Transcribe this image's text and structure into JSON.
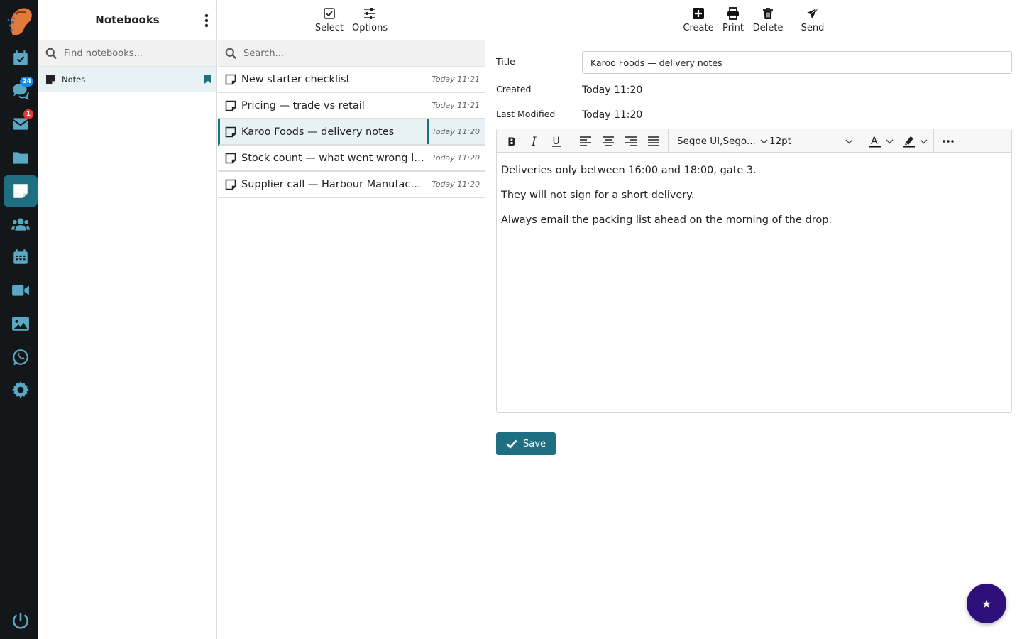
{
  "rail": {
    "items": [
      {
        "icon": "tasks-icon"
      },
      {
        "icon": "chat-icon",
        "badge": "24"
      },
      {
        "icon": "mail-icon",
        "badge": "1"
      },
      {
        "icon": "folder-icon"
      },
      {
        "icon": "notes-icon",
        "active": true
      },
      {
        "icon": "contacts-icon"
      },
      {
        "icon": "calendar-icon"
      },
      {
        "icon": "video-icon"
      },
      {
        "icon": "photos-icon"
      },
      {
        "icon": "whatsapp-icon"
      },
      {
        "icon": "settings-icon"
      },
      {
        "icon": "power-icon"
      }
    ]
  },
  "notebooks": {
    "title": "Notebooks",
    "search_placeholder": "Find notebooks...",
    "items": [
      {
        "label": "Notes"
      }
    ]
  },
  "notes_list": {
    "toolbar": {
      "select": "Select",
      "options": "Options"
    },
    "search_placeholder": "Search...",
    "items": [
      {
        "title": "New starter checklist",
        "time": "Today 11:21"
      },
      {
        "title": "Pricing — trade vs retail",
        "time": "Today 11:21"
      },
      {
        "title": "Karoo Foods — delivery notes",
        "time": "Today 11:20",
        "selected": true
      },
      {
        "title": "Stock count — what went wrong la...",
        "time": "Today 11:20"
      },
      {
        "title": "Supplier call — Harbour Manufactu...",
        "time": "Today 11:20"
      }
    ]
  },
  "editor": {
    "toolbar": {
      "create": "Create",
      "print": "Print",
      "delete": "Delete",
      "send": "Send"
    },
    "title_label": "Title",
    "title_value": "Karoo Foods — delivery notes",
    "created_label": "Created",
    "created_value": "Today 11:20",
    "modified_label": "Last Modified",
    "modified_value": "Today 11:20",
    "font_family": "Segoe UI,Sego...",
    "font_size": "12pt",
    "body": [
      "Deliveries only between 16:00 and 18:00, gate 3.",
      "They will not sign for a short delivery.",
      "Always email the packing list ahead on the morning of the drop."
    ],
    "save_label": "Save"
  },
  "colors": {
    "accent": "#1f6f83",
    "rail_bg": "#14171a",
    "fab": "#2e0f7a"
  }
}
